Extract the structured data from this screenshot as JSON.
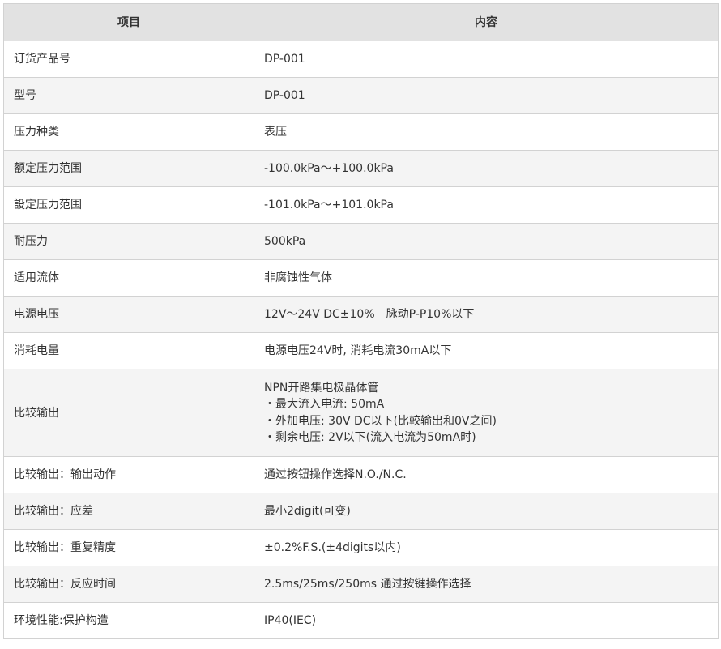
{
  "header": {
    "col1": "项目",
    "col2": "内容"
  },
  "rows": [
    {
      "label": "订货产品号",
      "value": "DP-001"
    },
    {
      "label": "型号",
      "value": "DP-001"
    },
    {
      "label": "压力种类",
      "value": "表压"
    },
    {
      "label": "额定压力范围",
      "value": "-100.0kPa～+100.0kPa"
    },
    {
      "label": "設定压力范围",
      "value": "-101.0kPa～+101.0kPa"
    },
    {
      "label": "耐压力",
      "value": "500kPa"
    },
    {
      "label": "适用流体",
      "value": "非腐蚀性气体"
    },
    {
      "label": "电源电压",
      "value": "12V～24V DC±10%　脉动P-P10%以下"
    },
    {
      "label": "消耗电量",
      "value": "电源电压24V时, 消耗电流30mA以下"
    },
    {
      "label": "比较输出",
      "lines": [
        "NPN开路集电极晶体管",
        "・最大流入电流: 50mA",
        "・外加电压: 30V DC以下(比較输出和0V之间)",
        "・剩余电压: 2V以下(流入电流为50mA时)"
      ]
    },
    {
      "label": "比较输出：输出动作",
      "value": "通过按钮操作选择N.O./N.C."
    },
    {
      "label": "比较输出：应差",
      "value": "最小2digit(可变)"
    },
    {
      "label": "比较输出：重复精度",
      "value": "±0.2%F.S.(±4digits以内)"
    },
    {
      "label": "比较输出：反应时间",
      "value": "2.5ms/25ms/250ms 通过按键操作选择"
    },
    {
      "label": "环境性能:保护构造",
      "value": "IP40(IEC)"
    }
  ]
}
